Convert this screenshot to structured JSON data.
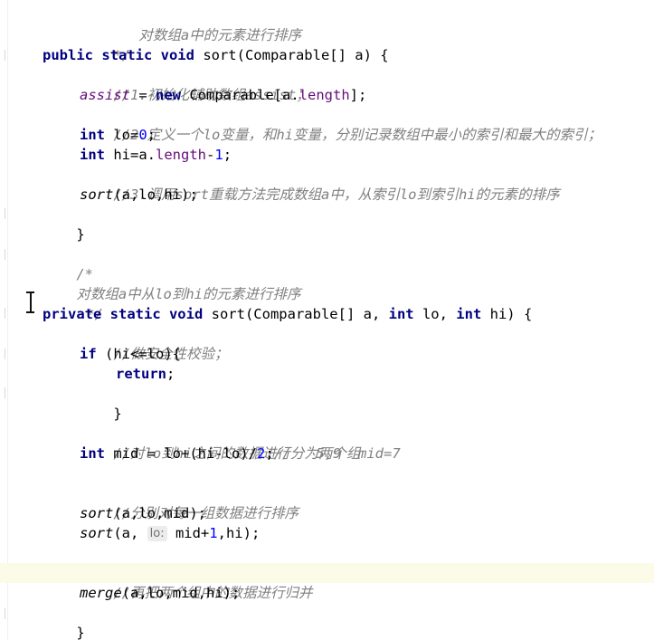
{
  "editor": {
    "lines": {
      "l01": "对数组a中的元素进行排序",
      "l02": "*/",
      "l03_kw": "public static void",
      "l03_rest": " sort(Comparable[] a) {",
      "l04": "//1.初始化辅助数组assist；",
      "l05_var": "assist",
      "l05_mid": " = ",
      "l05_kw": "new",
      "l05_type": " Comparable[a.",
      "l05_field": "length",
      "l05_end": "];",
      "l06": "//2.定义一个lo变量，和hi变量，分别记录数组中最小的索引和最大的索引；",
      "l07_kw": "int",
      "l07_rest": " lo=",
      "l07_num": "0",
      "l07_end": ";",
      "l08_kw": "int",
      "l08_rest": " hi=a.",
      "l08_field": "length",
      "l08_minus": "-",
      "l08_num": "1",
      "l08_end": ";",
      "l09": "//3.调用sort重载方法完成数组a中，从索引lo到索引hi的元素的排序",
      "l10_call": "sort",
      "l10_args": "(a,lo,hi);",
      "l11": "}",
      "l12": "/*",
      "l13": "对数组a中从lo到hi的元素进行排序",
      "l14": "*/",
      "l15_kw1": "private static void",
      "l15_mid": " sort(Comparable[] a, ",
      "l15_kw2": "int",
      "l15_mid2": " lo, ",
      "l15_kw3": "int",
      "l15_end": " hi) {",
      "l16": "//做安全性校验；",
      "l17_kw": "if",
      "l17_rest": " (hi<=lo){",
      "l18_kw": "return",
      "l18_end": ";",
      "l19": "}",
      "l20": "//对lo到hi之间的数据进行分为两个组",
      "l21_kw": "int",
      "l21_rest": " mid = lo+(hi-lo)/",
      "l21_num": "2",
      "l21_end": ";",
      "l21_comment": "//   5,9  mid=7",
      "l22": "//分别对每一组数据进行排序",
      "l23_call": "sort",
      "l23_args": "(a,lo,mid);",
      "l24_call": "sort",
      "l24_args1": "(a, ",
      "l24_hint": "lo:",
      "l24_args2": " mid+",
      "l24_num": "1",
      "l24_args3": ",hi);",
      "l25": "//再把两个组中的数据进行归并",
      "l26_call": "merge",
      "l26_args": "(a,lo,mid,hi);",
      "l27": "}"
    }
  },
  "colors": {
    "keyword": "#000080",
    "number": "#0000ff",
    "field": "#660e7a",
    "comment": "#808080",
    "current_line": "#fcfbe8"
  }
}
